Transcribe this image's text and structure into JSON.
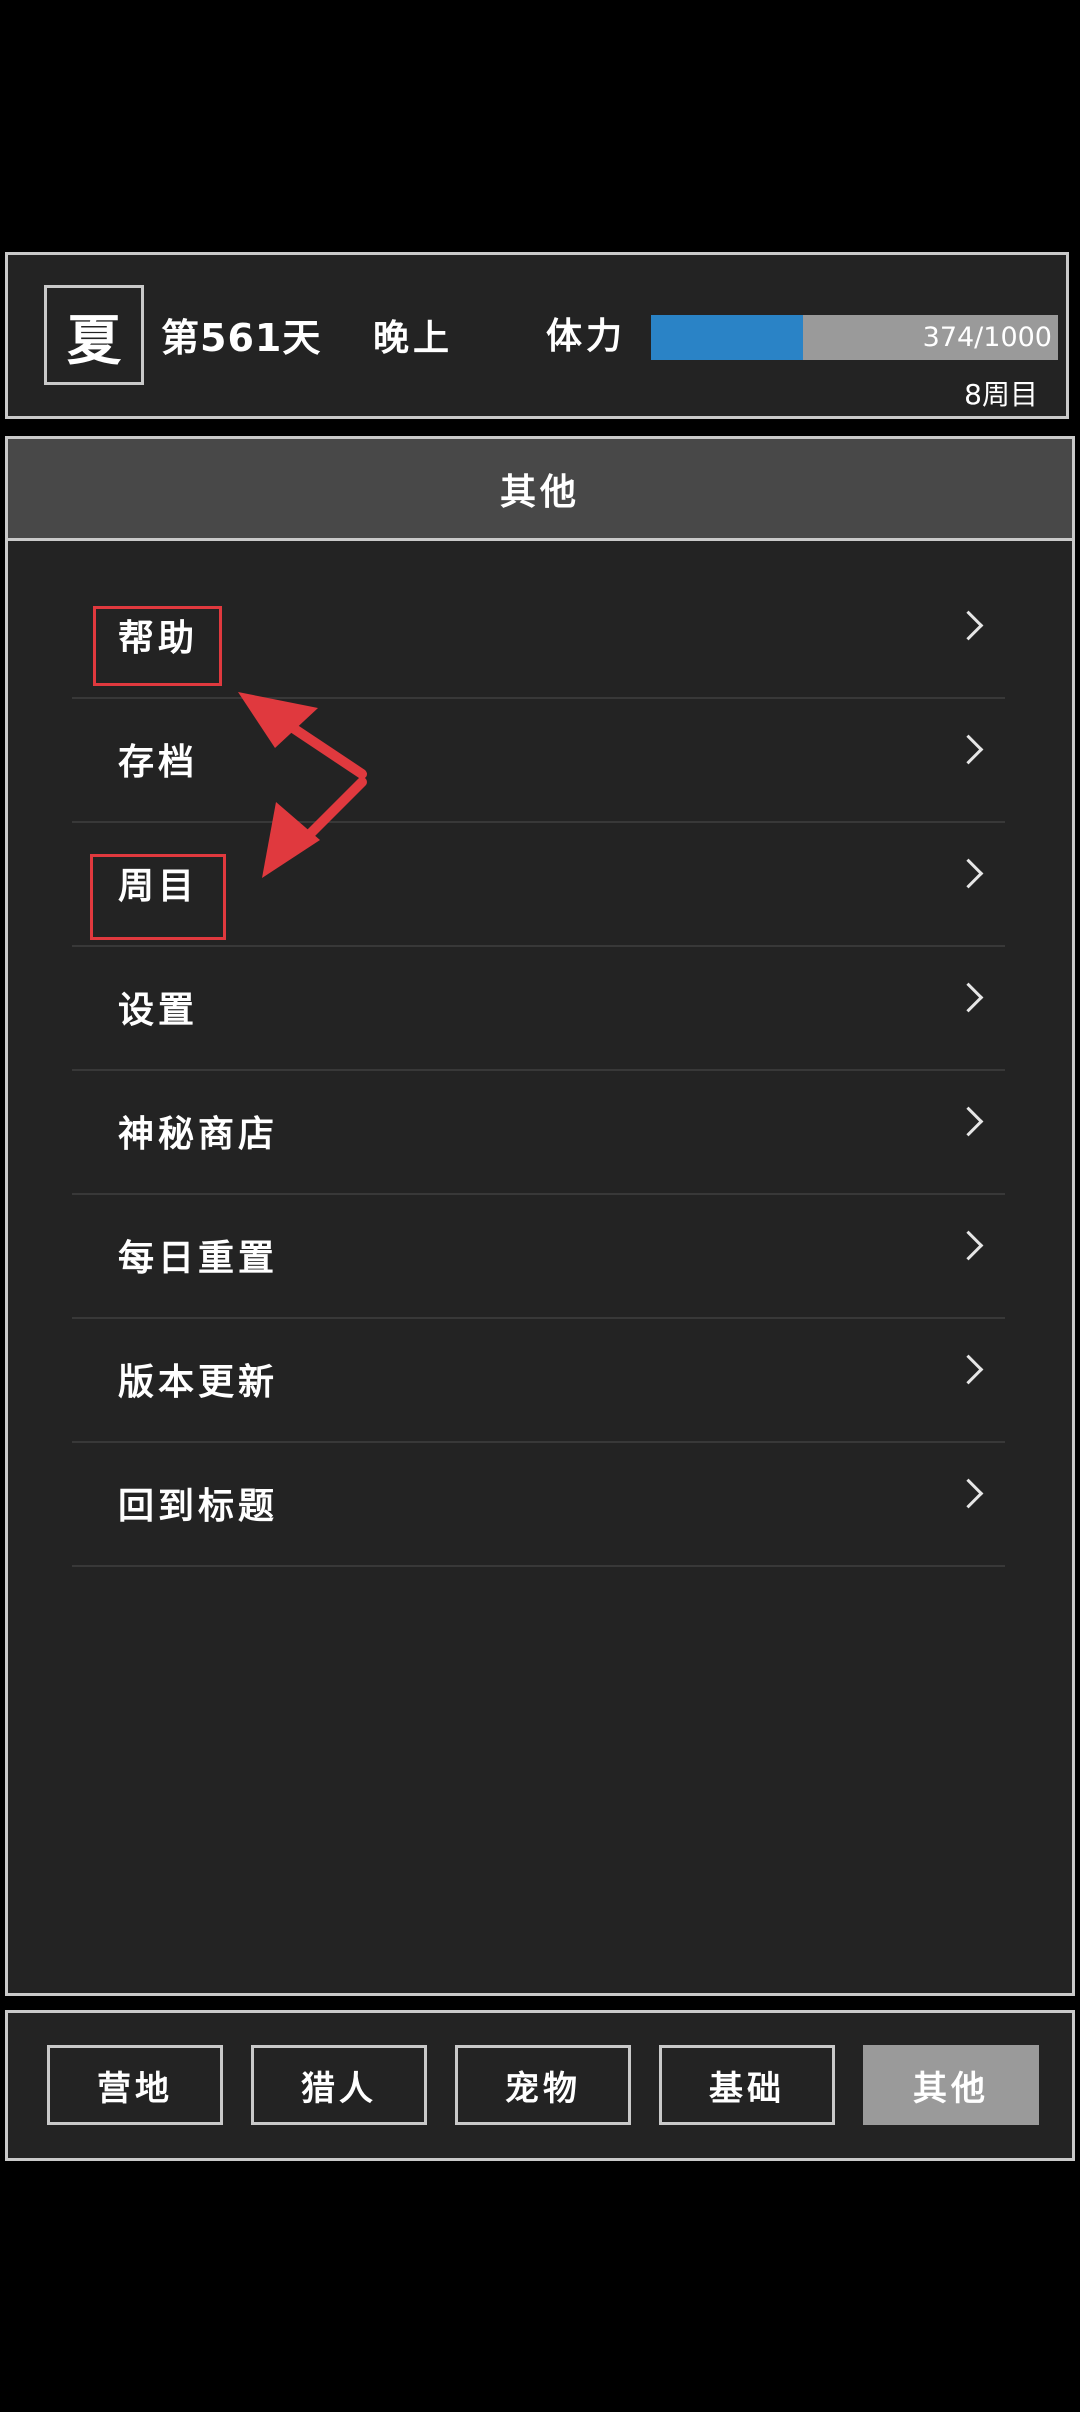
{
  "header": {
    "season": "夏",
    "day": "第561天",
    "time_of_day": "晚上",
    "stamina_label": "体力",
    "stamina_value": "374/1000",
    "stamina_fraction": 0.374,
    "cycle": "8周目"
  },
  "panel": {
    "title": "其他"
  },
  "menu": {
    "items": [
      {
        "label": "帮助"
      },
      {
        "label": "存档"
      },
      {
        "label": "周目"
      },
      {
        "label": "设置"
      },
      {
        "label": "神秘商店"
      },
      {
        "label": "每日重置"
      },
      {
        "label": "版本更新"
      },
      {
        "label": "回到标题"
      }
    ]
  },
  "tabs": [
    {
      "label": "营地",
      "active": false
    },
    {
      "label": "猎人",
      "active": false
    },
    {
      "label": "宠物",
      "active": false
    },
    {
      "label": "基础",
      "active": false
    },
    {
      "label": "其他",
      "active": true
    }
  ],
  "colors": {
    "background": "#000000",
    "panel": "#232323",
    "border": "#c9c9c9",
    "stamina_fill": "#2a83c6",
    "stamina_track": "#9a9a9a",
    "active_tab": "#9a9a9a",
    "annotation": "#e0393e"
  },
  "icons": {
    "menu_chevron": "chevron-right-icon"
  }
}
